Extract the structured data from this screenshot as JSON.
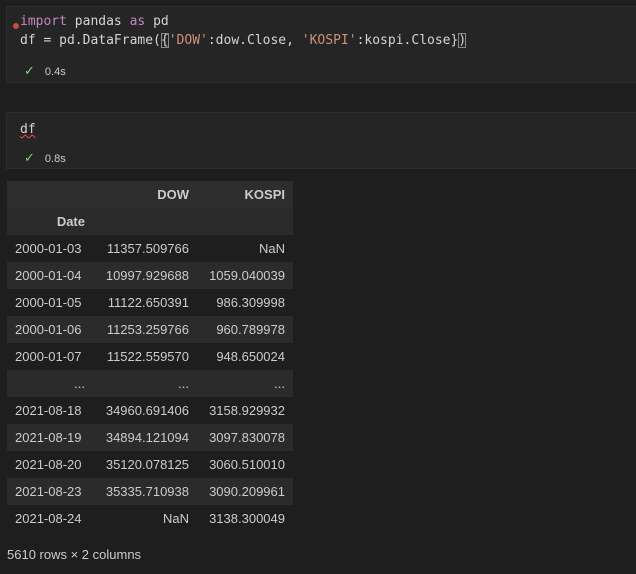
{
  "cell1": {
    "code_line1": [
      {
        "t": "import",
        "c": "kw"
      },
      {
        "t": " pandas ",
        "c": "id"
      },
      {
        "t": "as",
        "c": "kw"
      },
      {
        "t": " pd",
        "c": "id"
      }
    ],
    "code_line2": [
      {
        "t": "df = pd.DataFrame(",
        "c": "id"
      },
      {
        "t": "{",
        "c": "id"
      },
      {
        "t": "'DOW'",
        "c": "str"
      },
      {
        "t": ":dow.Close, ",
        "c": "id"
      },
      {
        "t": "'KOSPI'",
        "c": "str"
      },
      {
        "t": ":kospi.Close}",
        "c": "id"
      },
      {
        "t": ")",
        "c": "id"
      }
    ],
    "exec_time": "0.4s"
  },
  "cell2": {
    "code": "df",
    "exec_time": "0.8s"
  },
  "dataframe": {
    "columns": [
      "DOW",
      "KOSPI"
    ],
    "index_name": "Date",
    "rows": [
      {
        "date": "2000-01-03",
        "dow": "11357.509766",
        "kospi": "NaN"
      },
      {
        "date": "2000-01-04",
        "dow": "10997.929688",
        "kospi": "1059.040039"
      },
      {
        "date": "2000-01-05",
        "dow": "11122.650391",
        "kospi": "986.309998"
      },
      {
        "date": "2000-01-06",
        "dow": "11253.259766",
        "kospi": "960.789978"
      },
      {
        "date": "2000-01-07",
        "dow": "11522.559570",
        "kospi": "948.650024"
      },
      {
        "date": "...",
        "dow": "...",
        "kospi": "..."
      },
      {
        "date": "2021-08-18",
        "dow": "34960.691406",
        "kospi": "3158.929932"
      },
      {
        "date": "2021-08-19",
        "dow": "34894.121094",
        "kospi": "3097.830078"
      },
      {
        "date": "2021-08-20",
        "dow": "35120.078125",
        "kospi": "3060.510010"
      },
      {
        "date": "2021-08-23",
        "dow": "35335.710938",
        "kospi": "3090.209961"
      },
      {
        "date": "2021-08-24",
        "dow": "NaN",
        "kospi": "3138.300049"
      }
    ],
    "shape": "5610 rows × 2 columns"
  },
  "colors": {
    "keyword": "#c586c0",
    "string": "#ce9178",
    "success": "#89d185",
    "modified_dot": "#c74e39"
  },
  "icons": {
    "status": "check-icon",
    "modified": "unsaved-dot-icon"
  }
}
